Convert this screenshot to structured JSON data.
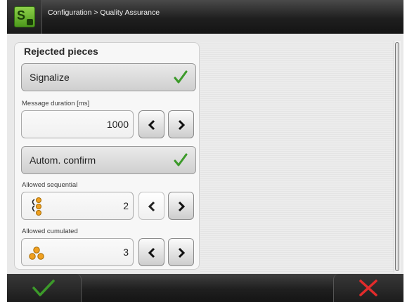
{
  "header": {
    "breadcrumb": "Configuration > Quality Assurance",
    "logo_icon": "s-app-logo-icon"
  },
  "panel": {
    "title": "Rejected pieces",
    "signalize": {
      "label": "Signalize",
      "checked": true
    },
    "message_duration": {
      "label": "Message duration [ms]",
      "value": "1000"
    },
    "autom_confirm": {
      "label": "Autom. confirm",
      "checked": true
    },
    "allowed_sequential": {
      "label": "Allowed sequential",
      "value": "2"
    },
    "allowed_cumulated": {
      "label": "Allowed cumulated",
      "value": "3"
    }
  },
  "colors": {
    "check_green": "#3c9a2a",
    "cancel_red": "#e32b2b",
    "accent_orange": "#f0a020"
  },
  "footer": {
    "confirm_icon": "green-check-icon",
    "cancel_icon": "red-x-icon"
  }
}
